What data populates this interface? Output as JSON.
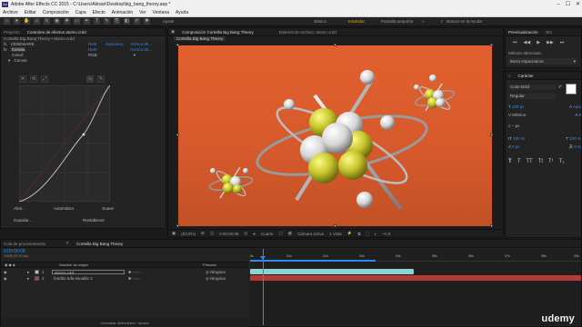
{
  "window": {
    "title": "Adobe After Effects CC 2015 - C:\\Users\\Abisan\\Desktop\\big_bang_theory.aep *",
    "app_icon": "Ae",
    "controls": [
      "–",
      "☐",
      "✕"
    ]
  },
  "menu": [
    "Archivo",
    "Editar",
    "Composición",
    "Capa",
    "Efecto",
    "Animación",
    "Ver",
    "Ventana",
    "Ayuda"
  ],
  "toolbar": {
    "align_label": "Ajuste",
    "workspace_items": [
      "Básico",
      "Estándar",
      "Pantalla pequeña"
    ],
    "active_workspace": "Estándar",
    "search_placeholder": "Buscar en la Ayuda"
  },
  "effects_panel": {
    "tabs": [
      "Proyecto",
      "Controles de efectos atomo.crdd"
    ],
    "active_tab": "Controles de efectos atomo.crdd",
    "breadcrumb": "Corteilla Big Bang Theory • atomo.crdd",
    "rows": [
      {
        "fx": "fx",
        "name": "CENEWARE",
        "col2": "Rest",
        "col3": "Opciones...",
        "col4": "Acerca de..."
      },
      {
        "fx": "fx",
        "name": "Curvas",
        "col2": "Rest",
        "col3": "",
        "col4": "Acerca de..."
      },
      {
        "fx": "",
        "name": "Canal:",
        "col2": "RGB",
        "col3": "",
        "col4": ""
      },
      {
        "fx": "",
        "name": "Curvas",
        "col2": "",
        "col3": "",
        "col4": ""
      }
    ],
    "buttons": [
      "Abrir...",
      "Automático",
      "Suave",
      "Guardar...",
      "Restablecer"
    ]
  },
  "composition": {
    "tabs": [
      "Composición Corteilla Big Bang Theory",
      "Material de archivo: atomo.crdd"
    ],
    "sub_tab": "Corteilla Big Bang Theory",
    "bottom_bar": {
      "zoom": "(53,9%)",
      "time": "0:00:00:08",
      "quality": "Cuarto",
      "camera": "Cámara activa",
      "views": "1 Vista",
      "exposure": "+0,0"
    }
  },
  "preview_panel": {
    "tabs": [
      "Previsualización",
      "Info"
    ],
    "shortcut_label": "Método abreviado",
    "shortcut_value": "Barra espaciadora"
  },
  "character_panel": {
    "tab": "Carácter",
    "font": "Code Bold",
    "style": "Regular",
    "size": "200 px",
    "leading": "Auto",
    "kerning": "Métrica",
    "tracking": "0",
    "stroke": "– px",
    "v_scale": "100 %",
    "h_scale": "100 %",
    "baseline": "0 px",
    "tsume": "0 %",
    "styles": [
      "T",
      "T",
      "TT",
      "Tt",
      "T¹",
      "T₁"
    ]
  },
  "timeline": {
    "tabs": [
      "Cola de procesamiento",
      "Corteilla Big Bang Theory"
    ],
    "active_tab": "Corteilla Big Bang Theory",
    "timecode": "0:00:00:08",
    "fps": "00008 (25,00 fps)",
    "column_header": "Nombre de origen",
    "parent_header": "Primario",
    "layers": [
      {
        "num": "1",
        "name": "atomo.c4d",
        "parent": "Ninguno",
        "color": "#8fd2d2"
      },
      {
        "num": "2",
        "name": "fondito tufa escalón 2",
        "parent": "Ninguno",
        "color": "#c43a3a"
      }
    ],
    "ruler": [
      "0s",
      "01s",
      "02s",
      "03s",
      "04s",
      "05s",
      "06s",
      "07s",
      "08s",
      "09s"
    ],
    "footer": "Conmutar definidores / modos"
  },
  "watermark": "udemy",
  "colors": {
    "accent": "#2d8ceb",
    "workspace": "#e0a400",
    "comp_bg": "#d75a2c",
    "layer1": "#8fd2d2",
    "layer2": "#c43a3a"
  }
}
